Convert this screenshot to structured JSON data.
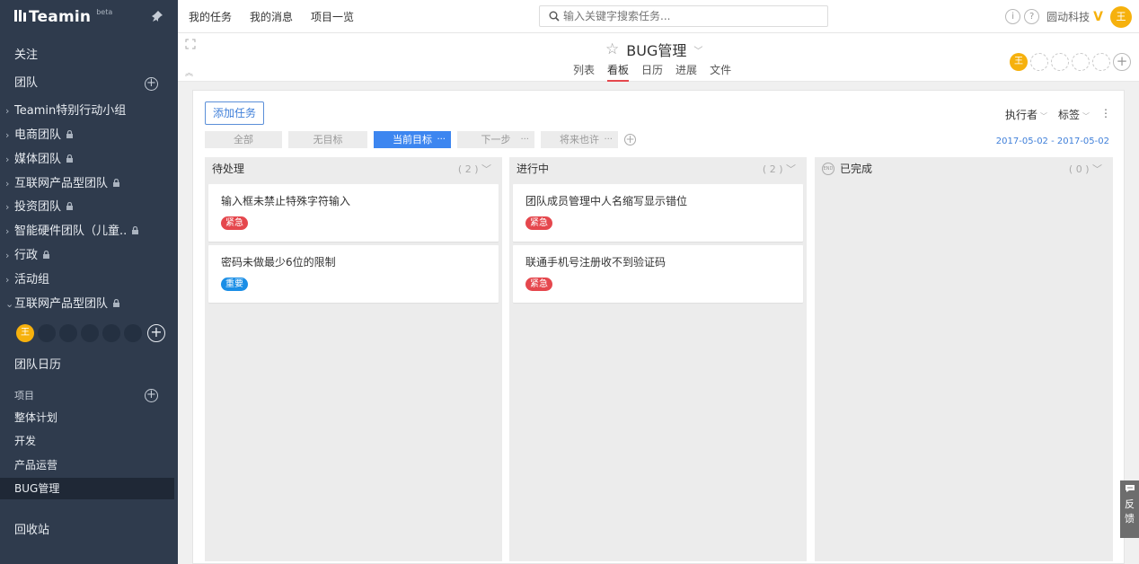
{
  "app": {
    "logo": "Teamin",
    "beta": "beta"
  },
  "sidebar": {
    "follow": "关注",
    "team": "团队",
    "teams": [
      {
        "label": "Teamin特别行动小组",
        "chev": "›",
        "locked": false
      },
      {
        "label": "电商团队",
        "chev": "›",
        "locked": true
      },
      {
        "label": "媒体团队",
        "chev": "›",
        "locked": true
      },
      {
        "label": "互联网产品型团队",
        "chev": "›",
        "locked": true
      },
      {
        "label": "投资团队",
        "chev": "›",
        "locked": true
      },
      {
        "label": "智能硬件团队（儿童..",
        "chev": "›",
        "locked": true
      },
      {
        "label": "行政",
        "chev": "›",
        "locked": true
      },
      {
        "label": "活动组",
        "chev": "›",
        "locked": false
      },
      {
        "label": "互联网产品型团队",
        "chev": "⌄",
        "locked": true
      }
    ],
    "member_me": "王",
    "team_calendar": "团队日历",
    "projects_label": "项目",
    "projects": [
      "整体计划",
      "开发",
      "产品运营",
      "BUG管理"
    ],
    "recycle": "回收站"
  },
  "topbar": {
    "nav": [
      "我的任务",
      "我的消息",
      "项目一览"
    ],
    "search_placeholder": "输入关键字搜索任务...",
    "info_icon": "i",
    "help_icon": "?",
    "company": "圆动科技",
    "vip": "V",
    "avatar": "王"
  },
  "project": {
    "title": "BUG管理",
    "tabs": [
      "列表",
      "看板",
      "日历",
      "进展",
      "文件"
    ],
    "active_tab": "看板",
    "member_me": "王"
  },
  "board": {
    "add_task": "添加任务",
    "assignee": "执行者",
    "label": "标签",
    "milestones": [
      {
        "label": "全部",
        "active": false,
        "more": false
      },
      {
        "label": "无目标",
        "active": false,
        "more": false
      },
      {
        "label": "当前目标",
        "active": true,
        "more": true
      },
      {
        "label": "下一步",
        "active": false,
        "more": true
      },
      {
        "label": "将来也许",
        "active": false,
        "more": true
      }
    ],
    "more": "···",
    "daterange": "2017-05-02 - 2017-05-02",
    "columns": [
      {
        "title": "待处理",
        "count": "( 2 )",
        "cards": [
          {
            "title": "输入框未禁止特殊字符输入",
            "tag": "紧急",
            "tag_type": "urgent"
          },
          {
            "title": "密码未做最少6位的限制",
            "tag": "重要",
            "tag_type": "important"
          }
        ]
      },
      {
        "title": "进行中",
        "count": "( 2 )",
        "cards": [
          {
            "title": "团队成员管理中人名缩写显示错位",
            "tag": "紧急",
            "tag_type": "urgent"
          },
          {
            "title": "联通手机号注册收不到验证码",
            "tag": "紧急",
            "tag_type": "urgent"
          }
        ]
      },
      {
        "title": "已完成",
        "count": "( 0 )",
        "end_icon": "END",
        "cards": []
      }
    ]
  },
  "feedback": {
    "line1": "反",
    "line2": "馈"
  },
  "colors": {
    "sidebar_bg": "#2f3b4d",
    "accent_blue": "#3d86f0",
    "urgent": "#e5474d",
    "important": "#1a8ee6",
    "avatar": "#f6b10d"
  }
}
